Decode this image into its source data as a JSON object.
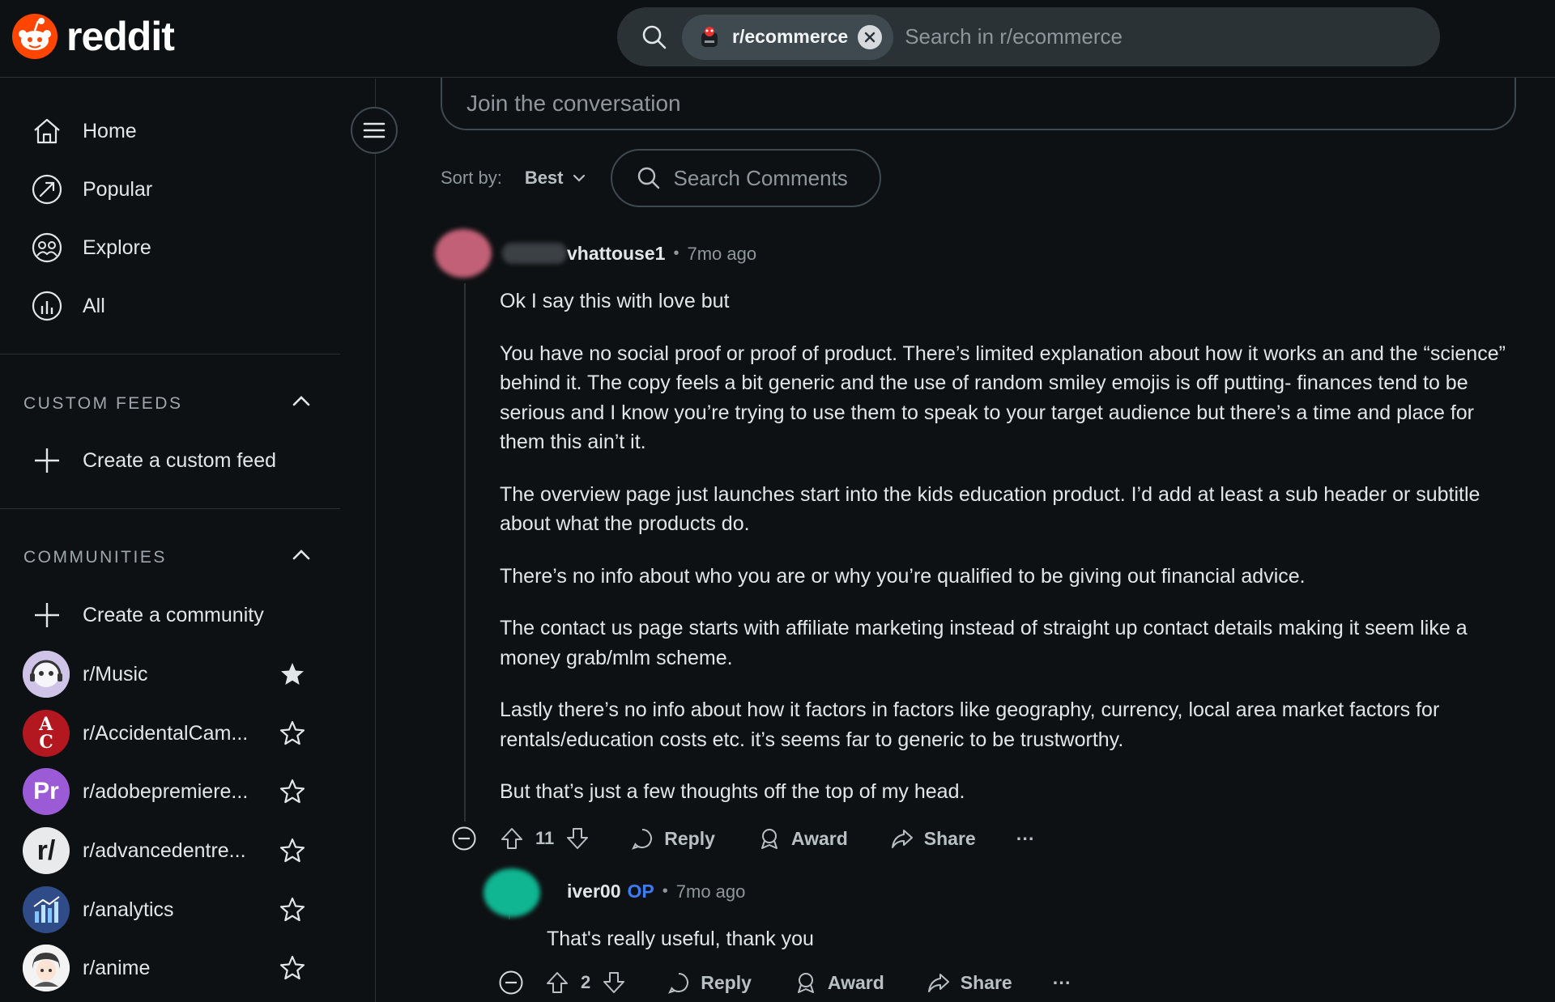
{
  "header": {
    "logo_text": "reddit",
    "search": {
      "scope_chip": "r/ecommerce",
      "placeholder": "Search in r/ecommerce"
    }
  },
  "sidebar": {
    "nav": [
      {
        "label": "Home",
        "icon": "home-icon"
      },
      {
        "label": "Popular",
        "icon": "popular-icon"
      },
      {
        "label": "Explore",
        "icon": "explore-icon"
      },
      {
        "label": "All",
        "icon": "all-icon"
      }
    ],
    "custom_feeds": {
      "title": "CUSTOM FEEDS",
      "create_label": "Create a custom feed"
    },
    "communities": {
      "title": "COMMUNITIES",
      "create_label": "Create a community",
      "items": [
        {
          "name": "r/Music",
          "favorited": true,
          "avatar_text": "",
          "avatar_color": "#e9d9f5"
        },
        {
          "name": "r/AccidentalCam...",
          "favorited": false,
          "avatar_text": "A C",
          "avatar_color": "#b3171f"
        },
        {
          "name": "r/adobepremiere...",
          "favorited": false,
          "avatar_text": "Pr",
          "avatar_color": "#9b5bd6"
        },
        {
          "name": "r/advancedentre...",
          "favorited": false,
          "avatar_text": "r/",
          "avatar_color": "#e9eaeb"
        },
        {
          "name": "r/analytics",
          "favorited": false,
          "avatar_text": "",
          "avatar_color": "#2f4b88"
        },
        {
          "name": "r/anime",
          "favorited": false,
          "avatar_text": "",
          "avatar_color": "#f3f3f3"
        }
      ]
    }
  },
  "main": {
    "join_placeholder": "Join the conversation",
    "sort_label": "Sort by:",
    "sort_value": "Best",
    "comment_search_placeholder": "Search Comments",
    "comments": [
      {
        "author": "vhattouse1",
        "time": "7mo ago",
        "paragraphs": [
          "Ok I say this with love but",
          "You have no social proof or proof of product. There’s limited explanation about how it works an and the “science” behind it. The copy feels a bit generic and the use of random smiley emojis is off putting- finances tend to be serious and I know you’re trying to use them to speak to your target audience but there’s a time and place for them this ain’t it.",
          "The overview page just launches start into the kids education product. I’d add at least a sub header or subtitle about what the products do.",
          "There’s no info about who you are or why you’re qualified to be giving out financial advice.",
          "The contact us page starts with affiliate marketing instead of straight up contact details making it seem like a money grab/mlm scheme.",
          "Lastly there’s no info about how it factors in factors like geography, currency, local area market factors for rentals/education costs etc. it’s seems far to generic to be trustworthy.",
          "But that’s just a few thoughts off the top of my head."
        ],
        "votes": "11",
        "actions": {
          "reply": "Reply",
          "award": "Award",
          "share": "Share",
          "more": "···"
        }
      },
      {
        "author": "iver00",
        "op_badge": "OP",
        "time": "7mo ago",
        "paragraphs": [
          "That's really useful, thank you"
        ],
        "votes": "2",
        "actions": {
          "reply": "Reply",
          "award": "Award",
          "share": "Share",
          "more": "···"
        }
      }
    ]
  },
  "colors": {
    "background": "#0e1113",
    "reddit_orange": "#ff4500",
    "op_blue": "#3d7cf5"
  }
}
